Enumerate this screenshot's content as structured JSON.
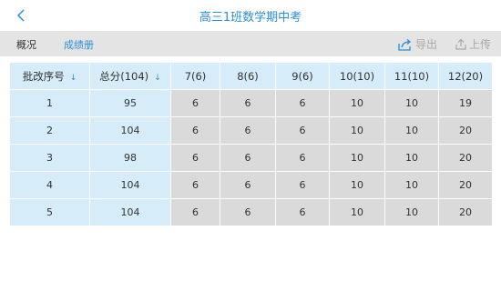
{
  "nav": {
    "title": "高三1班数学期中考"
  },
  "tabs": [
    {
      "label": "概况"
    },
    {
      "label": "成绩册"
    }
  ],
  "actions": {
    "export_label": "导出",
    "upload_label": "上传"
  },
  "table": {
    "headers": [
      {
        "label": "批改序号",
        "sort": "↓"
      },
      {
        "label": "总分(104)",
        "sort": "↓"
      },
      {
        "label": "7(6)"
      },
      {
        "label": "8(6)"
      },
      {
        "label": "9(6)"
      },
      {
        "label": "10(10)"
      },
      {
        "label": "11(10)"
      },
      {
        "label": "12(20)"
      }
    ],
    "rows": [
      [
        "1",
        "95",
        "6",
        "6",
        "6",
        "10",
        "10",
        "19"
      ],
      [
        "2",
        "104",
        "6",
        "6",
        "6",
        "10",
        "10",
        "20"
      ],
      [
        "3",
        "98",
        "6",
        "6",
        "6",
        "10",
        "10",
        "20"
      ],
      [
        "4",
        "104",
        "6",
        "6",
        "6",
        "10",
        "10",
        "20"
      ],
      [
        "5",
        "104",
        "6",
        "6",
        "6",
        "10",
        "10",
        "20"
      ]
    ]
  },
  "colors": {
    "accent": "#2a8fd8",
    "header_bg": "#d6ecf8",
    "cell_bg": "#dadada",
    "tabbar_bg": "#e4e4e4"
  },
  "icons": {
    "back": "chevron-left-icon",
    "export": "share-export-icon",
    "upload": "upload-icon"
  }
}
